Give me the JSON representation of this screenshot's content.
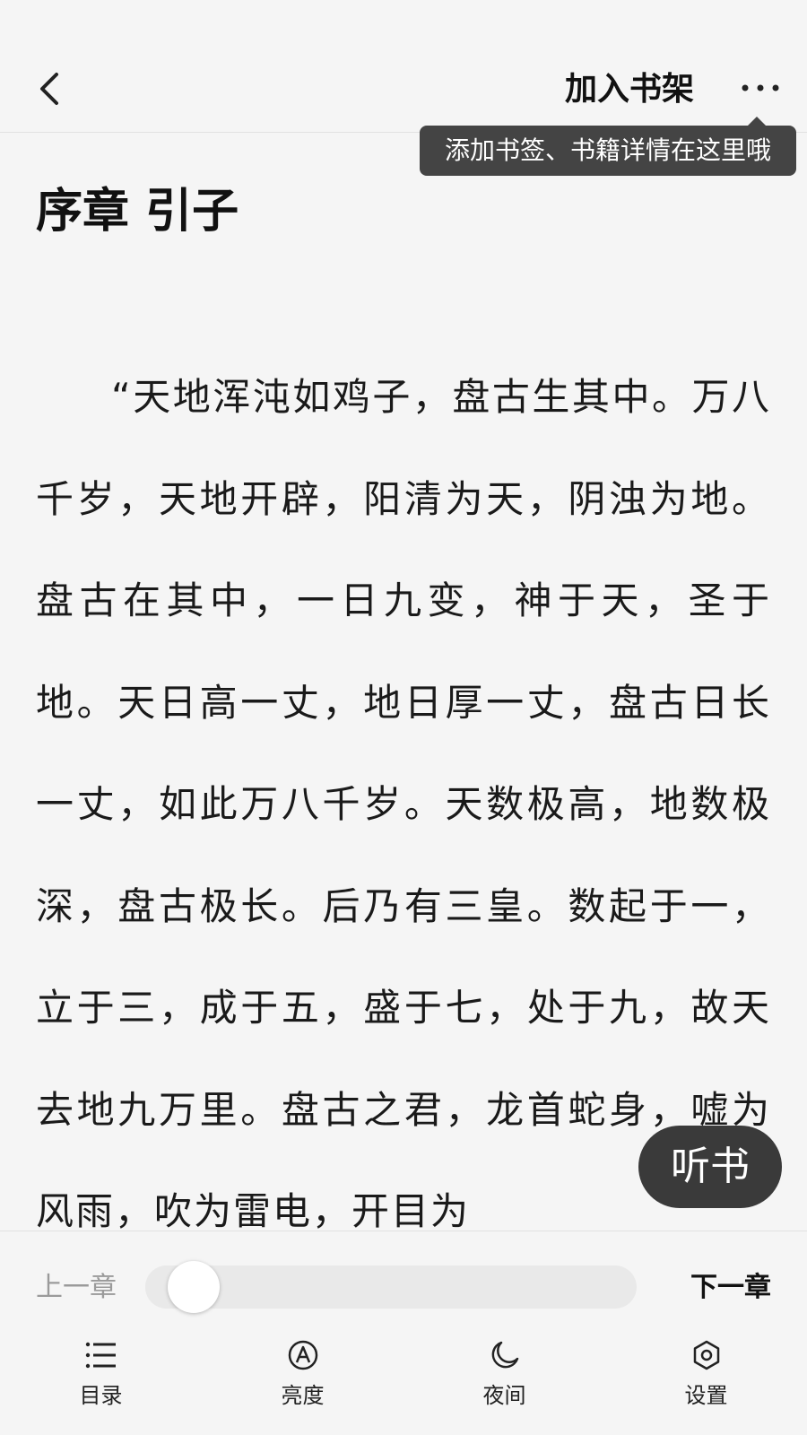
{
  "header": {
    "back_icon": "chevron-left-icon",
    "add_to_shelf": "加入书架",
    "more_icon": "more-dots-icon"
  },
  "tooltip": {
    "text": "添加书签、书籍详情在这里哦"
  },
  "chapter": {
    "title": "序章 引子",
    "body": "“天地浑沌如鸡子，盘古生其中。万八千岁，天地开辟，阳清为天，阴浊为地。盘古在其中，一日九变，神于天，圣于地。天日高一丈，地日厚一丈，盘古日长一丈，如此万八千岁。天数极高，地数极深，盘古极长。后乃有三皇。数起于一，立于三，成于五，盛于七，处于九，故天去地九万里。盘古之君，龙首蛇身，嘘为风雨，吹为雷电，开目为"
  },
  "listen_button": {
    "label": "听书"
  },
  "navigation": {
    "prev_label": "上一章",
    "next_label": "下一章",
    "progress": 0.05
  },
  "tabbar": {
    "items": [
      {
        "label": "目录",
        "icon": "list-icon"
      },
      {
        "label": "亮度",
        "icon": "brightness-icon"
      },
      {
        "label": "夜间",
        "icon": "moon-icon"
      },
      {
        "label": "设置",
        "icon": "settings-icon"
      }
    ]
  },
  "colors": {
    "background": "#f5f5f5",
    "tooltip_bg": "#444444",
    "listen_bg": "#3a3a3a",
    "text": "#1a1a1a",
    "muted": "#9a9a9a"
  }
}
